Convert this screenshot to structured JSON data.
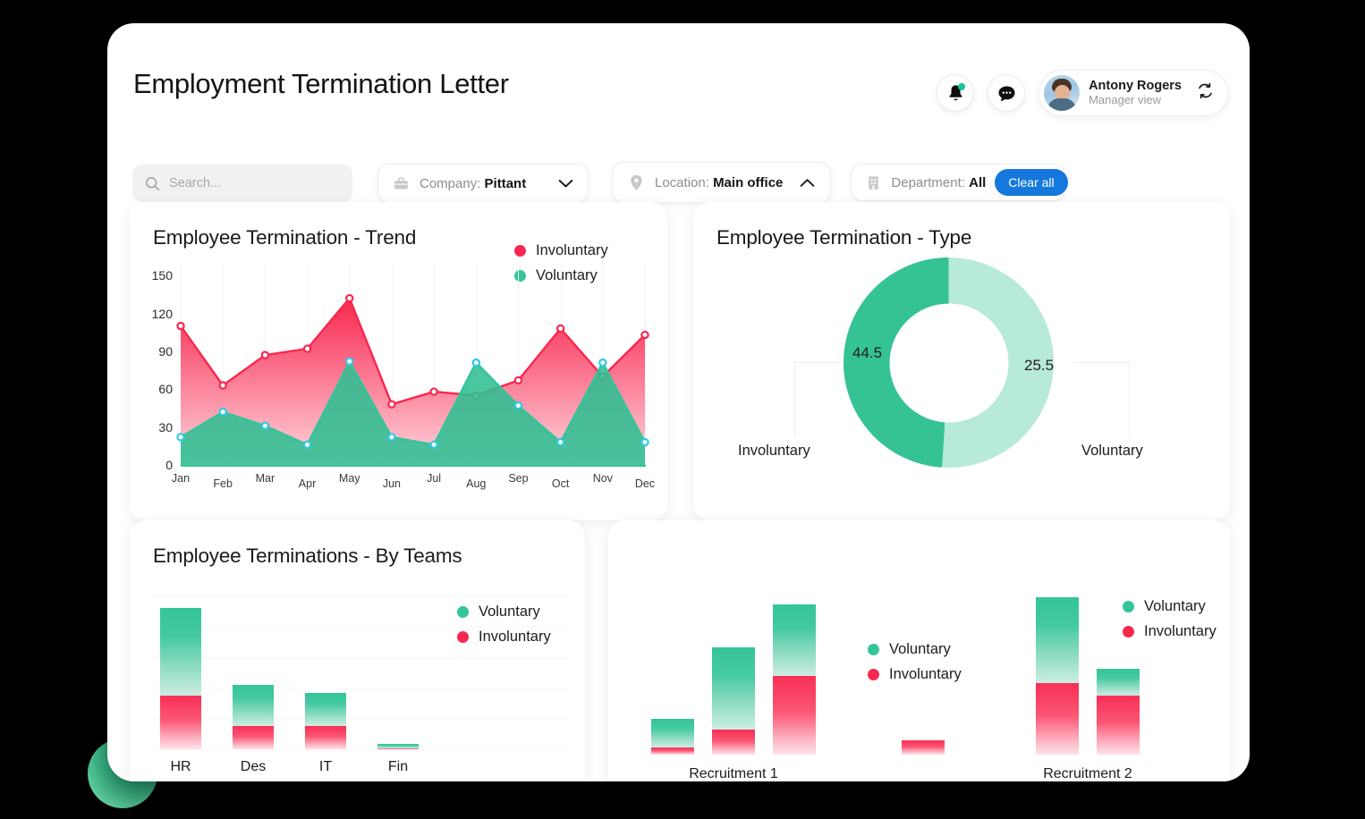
{
  "header": {
    "title": "Employment Termination Letter",
    "notifications_icon": "bell-icon",
    "messages_icon": "chat-bubble-icon",
    "user_name": "Antony Rogers",
    "user_role": "Manager view",
    "switch_icon": "refresh-icon"
  },
  "filters": {
    "search_placeholder": "Search...",
    "search_value": "",
    "company": {
      "label": "Company:",
      "value": "Pittant",
      "icon": "briefcase-icon",
      "chevron": "chevron-down-icon"
    },
    "location": {
      "label": "Location:",
      "value": "Main office",
      "icon": "map-pin-icon",
      "chevron": "chevron-up-icon"
    },
    "department": {
      "label": "Department:",
      "value": "All",
      "icon": "building-icon"
    },
    "clear_all": "Clear all",
    "accent_blue": "#1478dc"
  },
  "colors": {
    "involuntary": "#f8274f",
    "voluntary": "#35c49a",
    "voluntary_light": "#b8ead9"
  },
  "chart_data": [
    {
      "id": "trend",
      "type": "area",
      "title": "Employee Termination - Trend",
      "xlabel": "",
      "ylabel": "",
      "ylim": [
        0,
        160
      ],
      "yticks": [
        0,
        30,
        60,
        90,
        120,
        150
      ],
      "grid": true,
      "legend_position": "top-right",
      "categories": [
        "Jan",
        "Feb",
        "Mar",
        "Apr",
        "May",
        "Jun",
        "Jul",
        "Aug",
        "Sep",
        "Oct",
        "Nov",
        "Dec"
      ],
      "series": [
        {
          "name": "Involuntary",
          "color": "#f8274f",
          "values": [
            110,
            63,
            87,
            92,
            132,
            48,
            58,
            55,
            67,
            108,
            70,
            103
          ]
        },
        {
          "name": "Voluntary",
          "color": "#35c49a",
          "values": [
            22,
            42,
            31,
            16,
            82,
            22,
            16,
            81,
            47,
            18,
            81,
            18
          ]
        }
      ]
    },
    {
      "id": "type",
      "type": "pie",
      "title": "Employee Termination - Type",
      "slices": [
        {
          "label": "Involuntary",
          "value": 44.5,
          "color": "#35c295"
        },
        {
          "label": "Voluntary",
          "value": 25.5,
          "color": "#b8ead9"
        }
      ]
    },
    {
      "id": "teams",
      "type": "bar",
      "title": "Employee Terminations - By Teams",
      "stacked": true,
      "grid": true,
      "legend_position": "right",
      "legend": [
        "Voluntary",
        "Involuntary"
      ],
      "categories": [
        "HR",
        "Des",
        "IT",
        "Fin"
      ],
      "totals": [
        55,
        25,
        22,
        2
      ],
      "series": [
        {
          "name": "Voluntary",
          "color": "#35c49a",
          "values": [
            34,
            16,
            13,
            1.7
          ]
        },
        {
          "name": "Involuntary",
          "color": "#f8274f",
          "values": [
            21,
            9,
            9,
            0.3
          ]
        }
      ]
    },
    {
      "id": "recruitment",
      "type": "bar",
      "title": "",
      "stacked": true,
      "legend": [
        "Voluntary",
        "Involuntary"
      ],
      "groups": [
        {
          "label": "Recruitment 1",
          "bars": [
            {
              "total": 5,
              "voluntary": 4,
              "involuntary": 1
            },
            {
              "total": 15,
              "voluntary": 11.5,
              "involuntary": 3.5
            },
            {
              "total": 21,
              "voluntary": 10,
              "involuntary": 11
            }
          ]
        },
        {
          "label": "",
          "bars": [
            {
              "total": 2,
              "voluntary": 0,
              "involuntary": 2
            }
          ]
        },
        {
          "label": "Recruitment 2",
          "bars": [
            {
              "total": 22,
              "voluntary": 12,
              "involuntary": 10
            },
            {
              "total": 12,
              "voluntary": 5,
              "involuntary": 11
            }
          ]
        }
      ]
    }
  ]
}
